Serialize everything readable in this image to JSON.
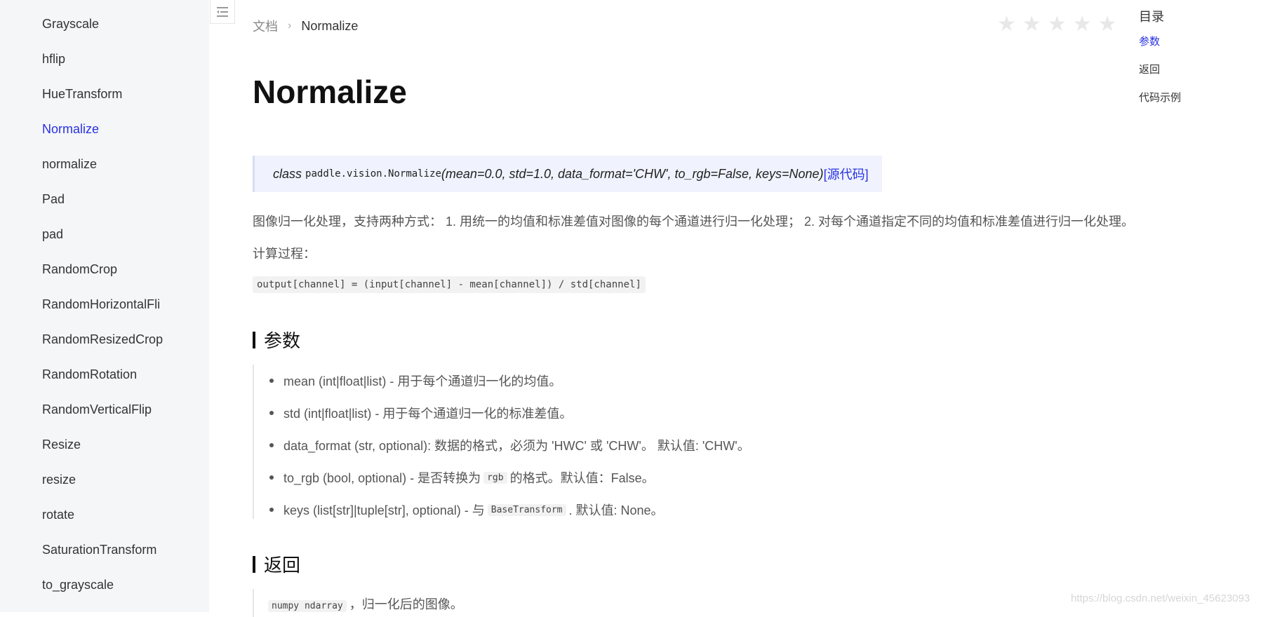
{
  "sidebar": {
    "items": [
      {
        "label": "Grayscale",
        "active": false
      },
      {
        "label": "hflip",
        "active": false
      },
      {
        "label": "HueTransform",
        "active": false
      },
      {
        "label": "Normalize",
        "active": true
      },
      {
        "label": "normalize",
        "active": false
      },
      {
        "label": "Pad",
        "active": false
      },
      {
        "label": "pad",
        "active": false
      },
      {
        "label": "RandomCrop",
        "active": false
      },
      {
        "label": "RandomHorizontalFli",
        "active": false
      },
      {
        "label": "RandomResizedCrop",
        "active": false
      },
      {
        "label": "RandomRotation",
        "active": false
      },
      {
        "label": "RandomVerticalFlip",
        "active": false
      },
      {
        "label": "Resize",
        "active": false
      },
      {
        "label": "resize",
        "active": false
      },
      {
        "label": "rotate",
        "active": false
      },
      {
        "label": "SaturationTransform",
        "active": false
      },
      {
        "label": "to_grayscale",
        "active": false
      }
    ],
    "collapse_icon": "menu-collapse-icon"
  },
  "breadcrumb": {
    "home": "文档",
    "separator": "›",
    "current": "Normalize"
  },
  "rating": {
    "stars_total": 5,
    "stars_filled": 0
  },
  "main": {
    "title": "Normalize",
    "signature": {
      "keyword": "class",
      "name": "paddle.vision.Normalize",
      "params": "(mean=0.0, std=1.0, data_format='CHW', to_rgb=False, keys=None)",
      "source_link": "[源代码]"
    },
    "description": "图像归一化处理，支持两种方式： 1. 用统一的均值和标准差值对图像的每个通道进行归一化处理； 2. 对每个通道指定不同的均值和标准差值进行归一化处理。",
    "calc_label": "计算过程：",
    "formula": "output[channel] = (input[channel] - mean[channel]) / std[channel]",
    "params_heading": "参数",
    "params": [
      {
        "text": "mean (int|float|list) - 用于每个通道归一化的均值。"
      },
      {
        "text": "std (int|float|list) - 用于每个通道归一化的标准差值。"
      },
      {
        "text": "data_format (str, optional): 数据的格式，必须为 'HWC' 或 'CHW'。 默认值: 'CHW'。"
      },
      {
        "pre": "to_rgb (bool, optional) - 是否转换为",
        "code": "rgb",
        "post": "的格式。默认值：False。"
      },
      {
        "pre": "keys (list[str]|tuple[str], optional) - 与",
        "code": "BaseTransform",
        "post": ". 默认值: None。"
      }
    ],
    "returns_heading": "返回",
    "returns": {
      "code": "numpy ndarray",
      "text": "，归一化后的图像。"
    }
  },
  "toc": {
    "title": "目录",
    "items": [
      {
        "label": "参数",
        "active": true
      },
      {
        "label": "返回",
        "active": false
      },
      {
        "label": "代码示例",
        "active": false
      }
    ]
  },
  "watermark": "https://blog.csdn.net/weixin_45623093",
  "colors": {
    "accent": "#2932e1",
    "sidebar_bg": "#f5f6f8",
    "signature_bg": "#f0f3fd"
  }
}
